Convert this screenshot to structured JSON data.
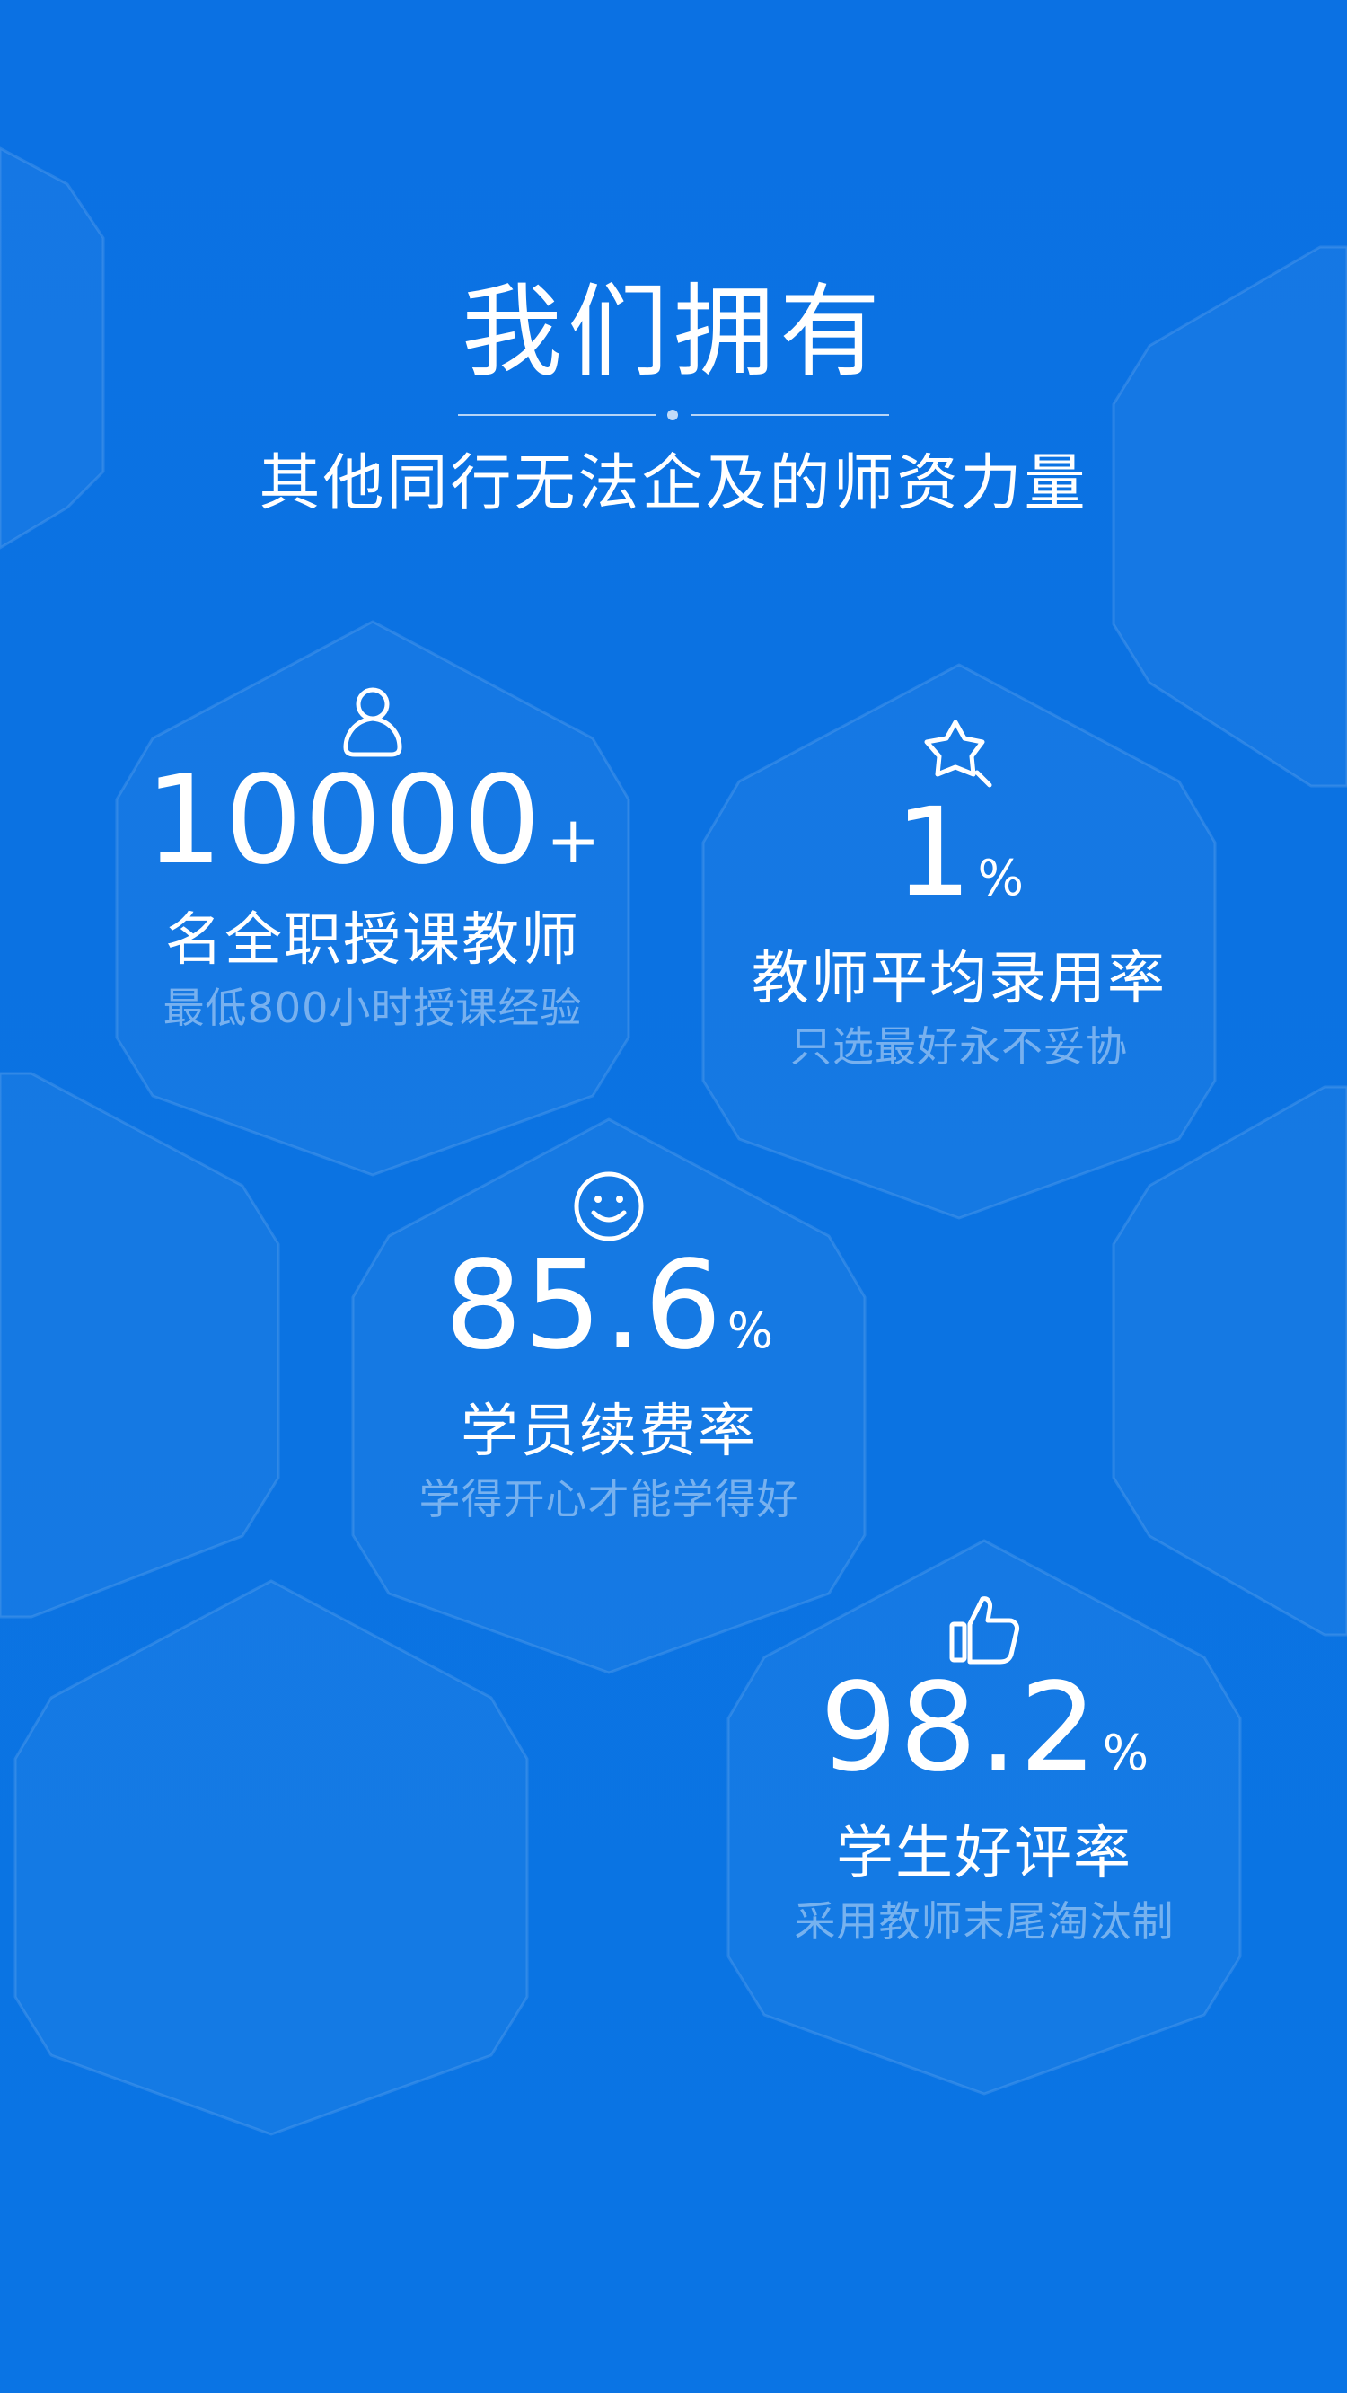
{
  "header": {
    "title": "我们拥有",
    "subtitle": "其他同行无法企及的师资力量"
  },
  "stats": [
    {
      "icon": "person-icon",
      "value": "10000",
      "unit": "+",
      "label": "名全职授课教师",
      "caption": "最低800小时授课经验"
    },
    {
      "icon": "star-search-icon",
      "value": "1",
      "unit": "%",
      "label": "教师平均录用率",
      "caption": "只选最好永不妥协"
    },
    {
      "icon": "smiley-icon",
      "value": "85.6",
      "unit": "%",
      "label": "学员续费率",
      "caption": "学得开心才能学得好"
    },
    {
      "icon": "thumbs-up-icon",
      "value": "98.2",
      "unit": "%",
      "label": "学生好评率",
      "caption": "采用教师末尾淘汰制"
    }
  ],
  "colors": {
    "background": "#0b73e2",
    "text": "#ffffff",
    "caption": "#7fb4f0"
  }
}
